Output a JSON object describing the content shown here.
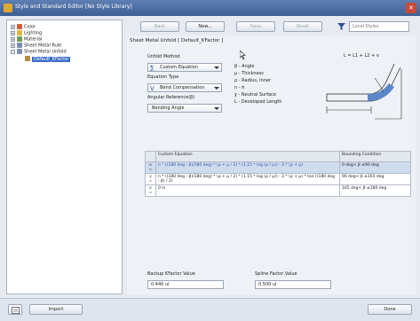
{
  "window": {
    "title": "Style and Standard Editor [No Style Library]"
  },
  "tree": [
    {
      "label": "Color",
      "color": "#d25b3a"
    },
    {
      "label": "Lighting",
      "color": "#e2b43c"
    },
    {
      "label": "Material",
      "color": "#6d9a55"
    },
    {
      "label": "Sheet Metal Rule",
      "color": "#7a8fb5"
    },
    {
      "label": "Sheet Metal Unfold",
      "color": "#7a8fb5"
    },
    {
      "label": "Default_KFactor",
      "color": "#b58a3c"
    }
  ],
  "toolbar": {
    "back": "Back",
    "new": "New...",
    "save": "Save",
    "reset": "Reset",
    "filter_placeholder": "Local Styles"
  },
  "main": {
    "title": "Sheet Metal Unfold [ Default_KFactor ]",
    "unfold_method_label": "Unfold Method",
    "unfold_method_value": "Custom Equation",
    "equation_type_label": "Equation Type",
    "equation_type_value": "Bend Compensation",
    "angular_reference_label": "Angular Reference(β)",
    "angular_reference_value": "Bending Angle",
    "legend": [
      "β - Angle",
      "μ - Thickness",
      "ρ - Radius, Inner",
      "n - π",
      "χ - Neutral Surface",
      "L - Developed Length"
    ],
    "formula": "L = L1 + L2 + v"
  },
  "table": {
    "headers": [
      "",
      "Custom Equation",
      "Bounding Condition"
    ],
    "rows": [
      {
        "op": "v =",
        "eq": "n * ((180 deg - β)/180 deg) * (ρ + μ / 2) * (1.15 * log (ρ / μ)) - 2 * (ρ + μ)",
        "cond": "0 deg< β ≤90 deg",
        "selected": true
      },
      {
        "op": "v =",
        "eq": "n * ((180 deg - β)/180 deg) * (ρ + μ / 2) * (1.15 * log (ρ / μ)) - 2 * (ρ + μ) * tan ((180 deg - β) / 2)",
        "cond": "90 deg< β ≤165 deg",
        "selected": false
      },
      {
        "op": "v =",
        "eq": "0 in",
        "cond": "165 deg< β ≤180 deg",
        "selected": false
      }
    ]
  },
  "backup": {
    "label": "Backup KFactor Value",
    "value": "0.440 ul"
  },
  "spline": {
    "label": "Spline Factor Value",
    "value": "0.500 ul"
  },
  "bottom": {
    "import": "Import",
    "done": "Done"
  }
}
